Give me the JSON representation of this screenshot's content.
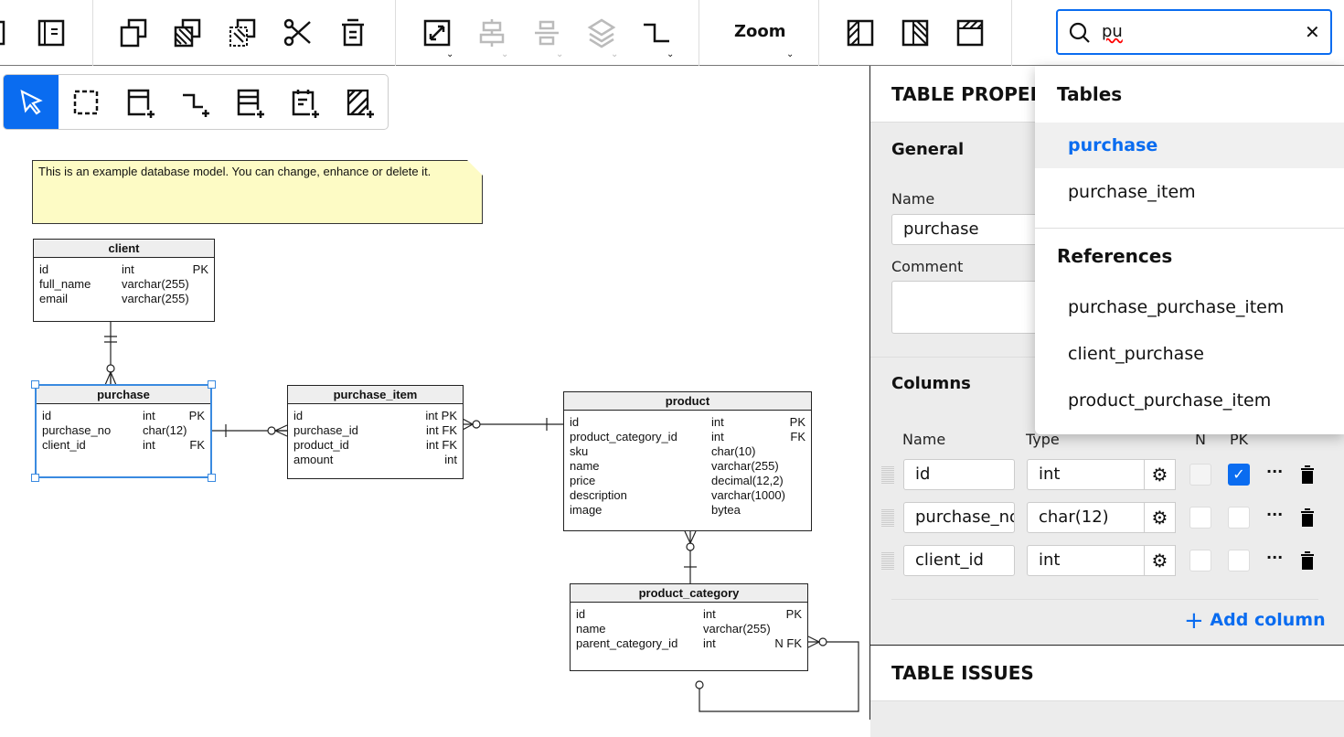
{
  "toolbar": {
    "zoom_label": "Zoom",
    "search_value": "pu"
  },
  "note": "This is an example database model. You can change, enhance or delete it.",
  "tables": [
    {
      "name": "client",
      "rows": [
        [
          "id",
          "int",
          "PK"
        ],
        [
          "full_name",
          "varchar(255)",
          ""
        ],
        [
          "email",
          "varchar(255)",
          ""
        ]
      ]
    },
    {
      "name": "purchase",
      "rows": [
        [
          "id",
          "int",
          "PK"
        ],
        [
          "purchase_no",
          "char(12)",
          ""
        ],
        [
          "client_id",
          "int",
          "FK"
        ]
      ]
    },
    {
      "name": "purchase_item",
      "rows": [
        [
          "id",
          "",
          "int PK"
        ],
        [
          "purchase_id",
          "",
          "int FK"
        ],
        [
          "product_id",
          "",
          "int FK"
        ],
        [
          "amount",
          "",
          "int"
        ]
      ]
    },
    {
      "name": "product",
      "rows": [
        [
          "id",
          "int",
          "PK"
        ],
        [
          "product_category_id",
          "int",
          "FK"
        ],
        [
          "sku",
          "char(10)",
          ""
        ],
        [
          "name",
          "varchar(255)",
          ""
        ],
        [
          "price",
          "decimal(12,2)",
          ""
        ],
        [
          "description",
          "varchar(1000)",
          ""
        ],
        [
          "image",
          "bytea",
          ""
        ]
      ]
    },
    {
      "name": "product_category",
      "rows": [
        [
          "id",
          "int",
          "PK"
        ],
        [
          "name",
          "varchar(255)",
          ""
        ],
        [
          "parent_category_id",
          "int",
          "N FK"
        ]
      ]
    }
  ],
  "panel": {
    "title": "TABLE PROPERTIES",
    "general": "General",
    "name_label": "Name",
    "name_value": "purchase",
    "comment_label": "Comment",
    "columns_title": "Columns",
    "col_headers": {
      "name": "Name",
      "type": "Type",
      "n": "N",
      "pk": "PK"
    },
    "columns": [
      {
        "name": "id",
        "type": "int",
        "n": false,
        "pk": true
      },
      {
        "name": "purchase_no",
        "type": "char(12)",
        "n": false,
        "pk": false
      },
      {
        "name": "client_id",
        "type": "int",
        "n": false,
        "pk": false
      }
    ],
    "add_column": "Add column",
    "issues_title": "TABLE ISSUES"
  },
  "dropdown": {
    "tables_header": "Tables",
    "tables": [
      "purchase",
      "purchase_item"
    ],
    "references_header": "References",
    "references": [
      "purchase_purchase_item",
      "client_purchase",
      "product_purchase_item"
    ]
  },
  "colors": {
    "accent": "#0a6cf0",
    "note": "#fdfbc5",
    "selection": "#3a8ae0"
  }
}
